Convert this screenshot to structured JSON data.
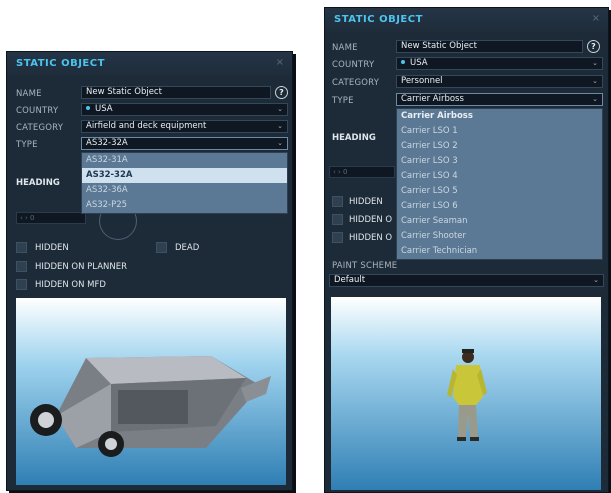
{
  "panel_left": {
    "title": "STATIC OBJECT",
    "close_glyph": "×",
    "name_label": "NAME",
    "name_value": "New Static Object",
    "help_glyph": "?",
    "country_label": "COUNTRY",
    "country_value": "USA",
    "category_label": "CATEGORY",
    "category_value": "Airfield and deck equipment",
    "type_label": "TYPE",
    "type_value": "AS32-32A",
    "type_options": [
      "AS32-31A",
      "AS32-32A",
      "AS32-36A",
      "AS32-P25"
    ],
    "type_selected": "AS32-32A",
    "heading_label": "HEADING",
    "heading_field": "‹ › 0",
    "hidden_label": "HIDDEN",
    "dead_label": "DEAD",
    "hidden_planner_label": "HIDDEN ON PLANNER",
    "hidden_mfd_label": "HIDDEN ON MFD",
    "chevron_glyph": "⌄"
  },
  "panel_right": {
    "title": "STATIC OBJECT",
    "close_glyph": "×",
    "name_label": "NAME",
    "name_value": "New Static Object",
    "help_glyph": "?",
    "country_label": "COUNTRY",
    "country_value": "USA",
    "category_label": "CATEGORY",
    "category_value": "Personnel",
    "type_label": "TYPE",
    "type_value": "Carrier Airboss",
    "type_options": [
      "Carrier Airboss",
      "Carrier LSO 1",
      "Carrier LSO 2",
      "Carrier LSO 3",
      "Carrier LSO 4",
      "Carrier LSO 5",
      "Carrier LSO 6",
      "Carrier Seaman",
      "Carrier Shooter",
      "Carrier Technician"
    ],
    "heading_label": "HEADING",
    "heading_field": "‹ › 0",
    "hidden_label": "HIDDEN",
    "hidden_on_label_a": "HIDDEN O",
    "hidden_on_label_b": "HIDDEN O",
    "paint_scheme_label": "PAINT SCHEME",
    "paint_scheme_value": "Default",
    "chevron_glyph": "⌄"
  },
  "colors": {
    "panel_bg": "#1d2b38",
    "title_accent": "#4cc4ee",
    "dropdown_bg": "#5b7994",
    "selected_option_bg": "#cfe0ee"
  }
}
